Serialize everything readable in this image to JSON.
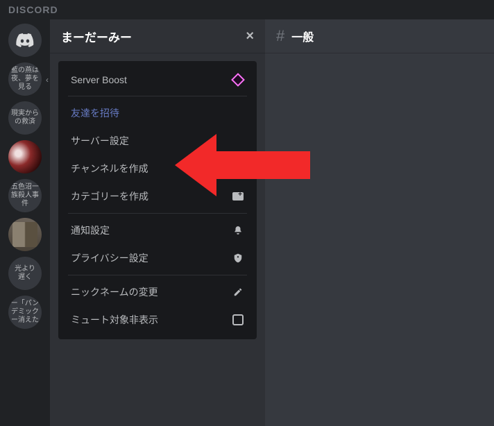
{
  "brand": "DISCORD",
  "servers": [
    {
      "type": "home",
      "label": ""
    },
    {
      "type": "text",
      "label": "藍の燕は\n夜、夢を\n見る"
    },
    {
      "type": "text",
      "label": "現実から\nの救済"
    },
    {
      "type": "image1",
      "label": ""
    },
    {
      "type": "text",
      "label": "五色沼一\n族殺人事\n件"
    },
    {
      "type": "image2",
      "label": ""
    },
    {
      "type": "text",
      "label": "光より\n遅く"
    },
    {
      "type": "text",
      "label": "ー「パン\nデミック\nー消えた"
    }
  ],
  "server_header": {
    "title": "まーだーみー"
  },
  "channel_header": {
    "name": "一般"
  },
  "menu": {
    "boost": "Server Boost",
    "invite": "友達を招待",
    "settings": "サーバー設定",
    "create_channel": "チャンネルを作成",
    "create_category": "カテゴリーを作成",
    "notification": "通知設定",
    "privacy": "プライバシー設定",
    "nickname": "ニックネームの変更",
    "hide_muted": "ミュート対象非表示"
  },
  "annotation": {
    "arrow_color": "#f22929",
    "arrow_points_to": "server_settings"
  }
}
